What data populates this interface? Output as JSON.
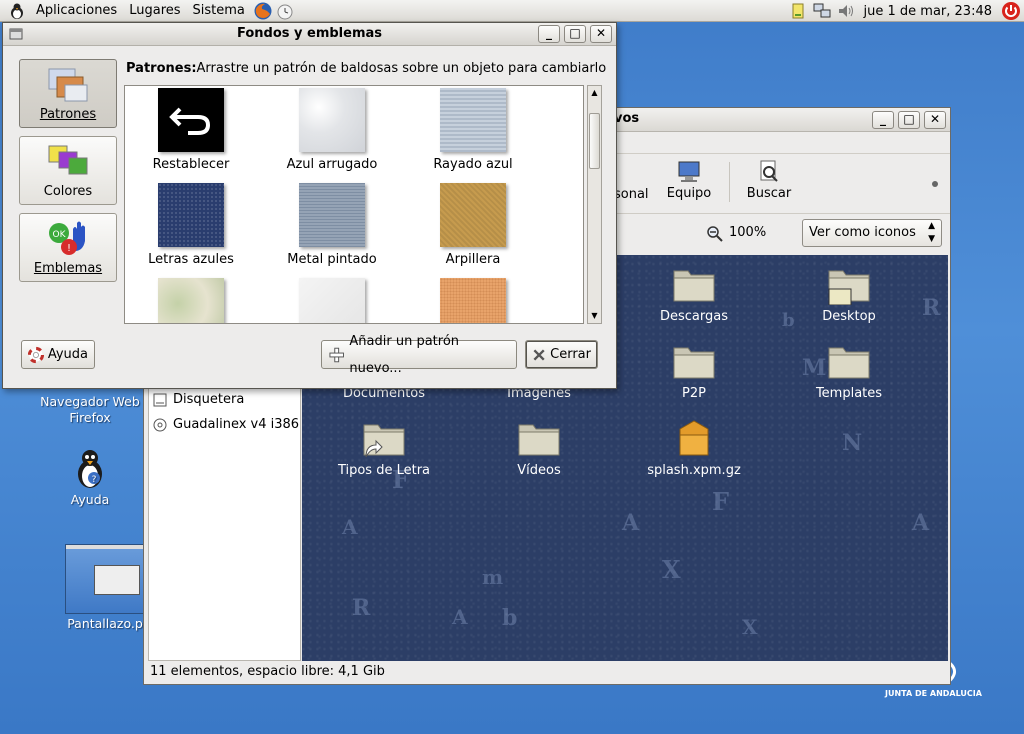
{
  "top_panel": {
    "menus": [
      "Aplicaciones",
      "Lugares",
      "Sistema"
    ],
    "clock": "jue   1 de mar, 23:48"
  },
  "desktop": {
    "icons": [
      {
        "label_line1": "Navegador Web",
        "label_line2": "Firefox"
      },
      {
        "label": "Ayuda"
      },
      {
        "label": "Pantallazo.p"
      }
    ],
    "corner_logo": "JUNTA DE ANDALUCIA"
  },
  "file_manager": {
    "title": "vos",
    "toolbar": {
      "personal_label": "sonal",
      "computer_label": "Equipo",
      "search_label": "Buscar"
    },
    "zoom": "100%",
    "view_mode": "Ver como iconos",
    "sidebar_items": [
      "Disquetera",
      "Guadalinex v4 i386"
    ],
    "files": [
      "Descargas",
      "Desktop",
      "Documentos",
      "Imágenes",
      "P2P",
      "Templates",
      "Tipos de Letra",
      "Vídeos",
      "splash.xpm.gz"
    ],
    "status": "11 elementos, espacio libre: 4,1 Gib"
  },
  "dialog": {
    "title": "Fondos y emblemas",
    "categories": [
      "Patrones",
      "Colores",
      "Emblemas"
    ],
    "heading_bold": "Patrones:",
    "heading_text": "Arrastre un patrón de baldosas sobre un objeto para cambiarlo",
    "patterns": [
      "Restablecer",
      "Azul arrugado",
      "Rayado azul",
      "Letras azules",
      "Metal pintado",
      "Arpillera"
    ],
    "help_label": "Ayuda",
    "add_label": "Añadir un patrón nuevo...",
    "close_label": "Cerrar"
  }
}
